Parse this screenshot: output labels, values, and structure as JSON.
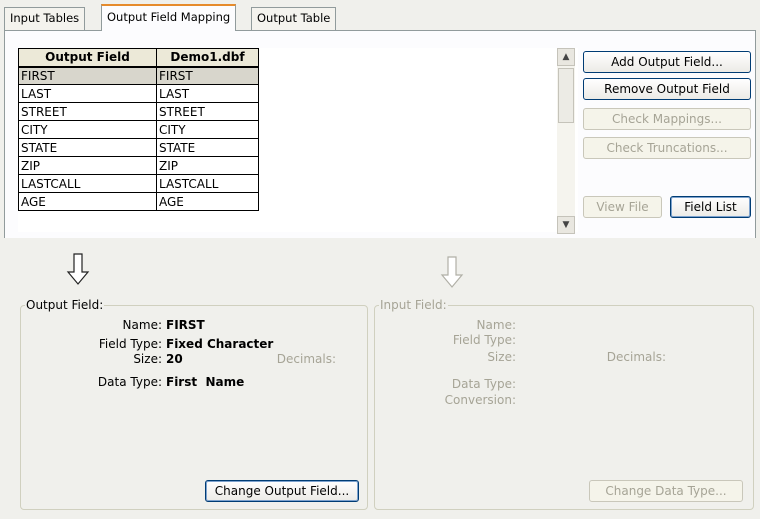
{
  "tabs": [
    "Input Tables",
    "Output Field Mapping",
    "Output Table"
  ],
  "grid": {
    "headers": [
      "Output Field",
      "Demo1.dbf"
    ],
    "rows": [
      [
        "FIRST",
        "FIRST"
      ],
      [
        "LAST",
        "LAST"
      ],
      [
        "STREET",
        "STREET"
      ],
      [
        "CITY",
        "CITY"
      ],
      [
        "STATE",
        "STATE"
      ],
      [
        "ZIP",
        "ZIP"
      ],
      [
        "LASTCALL",
        "LASTCALL"
      ],
      [
        "AGE",
        "AGE"
      ]
    ]
  },
  "buttons": {
    "add_output_field": "Add Output Field...",
    "remove_output_field": "Remove Output Field",
    "check_mappings": "Check Mappings...",
    "check_truncations": "Check Truncations...",
    "view_file": "View File",
    "field_list": "Field List",
    "change_output_field": "Change Output Field...",
    "change_data_type": "Change Data Type..."
  },
  "output_field": {
    "legend": "Output Field:",
    "name_label": "Name:",
    "name": "FIRST",
    "field_type_label": "Field Type:",
    "field_type": "Fixed Character",
    "size_label": "Size:",
    "size": "20",
    "decimals_label": "Decimals:",
    "data_type_label": "Data Type:",
    "data_type": "First  Name"
  },
  "input_field": {
    "legend": "Input Field:",
    "name_label": "Name:",
    "field_type_label": "Field Type:",
    "size_label": "Size:",
    "decimals_label": "Decimals:",
    "data_type_label": "Data Type:",
    "conversion_label": "Conversion:"
  }
}
